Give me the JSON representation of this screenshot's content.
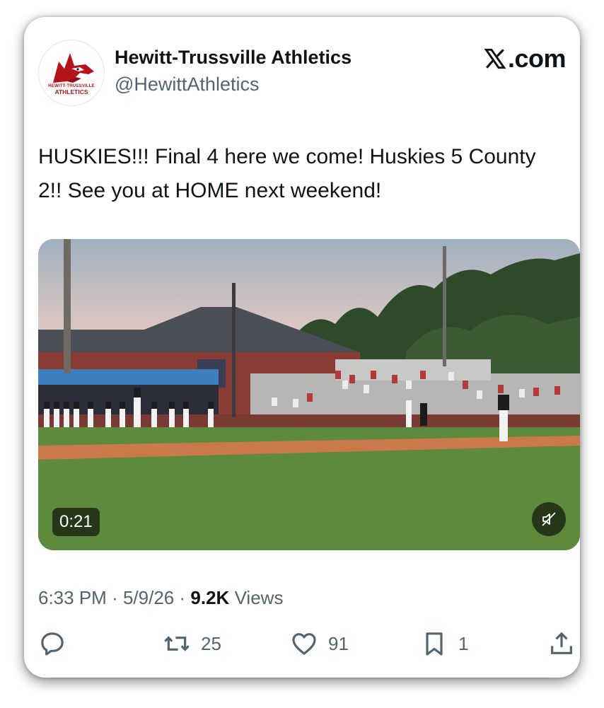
{
  "author": {
    "name": "Hewitt-Trussville Athletics",
    "handle": "@HewittAthletics",
    "avatar_line1": "HEWITT-TRUSSVILLE",
    "avatar_line2": "ATHLETICS"
  },
  "platform": {
    "logo_text": ".com"
  },
  "tweet": {
    "text": "HUSKIES!!! Final 4 here we come! Huskies 5 County 2!! See you at HOME next weekend!"
  },
  "media": {
    "duration": "0:21",
    "mute_icon": "speaker-muted-icon"
  },
  "meta": {
    "time": "6:33 PM",
    "date": "5/9/26",
    "views_count": "9.2K",
    "views_label": "Views",
    "separator": "·"
  },
  "actions": {
    "reply_icon": "reply-icon",
    "retweet_icon": "retweet-icon",
    "retweet_count": "25",
    "like_icon": "heart-icon",
    "like_count": "91",
    "bookmark_icon": "bookmark-icon",
    "bookmark_count": "1",
    "share_icon": "share-icon"
  },
  "colors": {
    "brand_red": "#b5121b",
    "text_primary": "#0f1419",
    "text_secondary": "#536471"
  }
}
